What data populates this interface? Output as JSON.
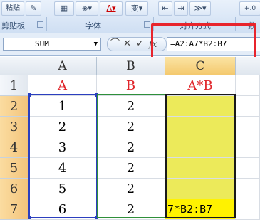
{
  "ribbon": {
    "groups": [
      {
        "label": "剪贴板"
      },
      {
        "label": "字体"
      },
      {
        "label": "对齐方式"
      },
      {
        "label": "数"
      }
    ],
    "font_color_button": "A",
    "wen_button": "变"
  },
  "formula_bar": {
    "name_box": "SUM",
    "formula": "=A2:A7*B2:B7",
    "fx_label": "fx"
  },
  "columns": [
    "A",
    "B",
    "C"
  ],
  "rows": [
    "1",
    "2",
    "3",
    "4",
    "5",
    "6",
    "7"
  ],
  "cells": {
    "A1": "A",
    "B1": "B",
    "C1": "A*B",
    "A2": "1",
    "B2": "2",
    "A3": "2",
    "B3": "2",
    "A4": "3",
    "B4": "2",
    "A5": "4",
    "B5": "2",
    "A6": "5",
    "B6": "2",
    "A7": "6",
    "B7": "2",
    "C7": "7*B2:B7"
  },
  "colors": {
    "header_text": "#e0262b",
    "highlight_yellow": "#ecea5a",
    "edit_yellow": "#fff200",
    "callout_red": "#e8242c",
    "range_a": "#2b3fbf",
    "range_b": "#2f8f3a"
  }
}
